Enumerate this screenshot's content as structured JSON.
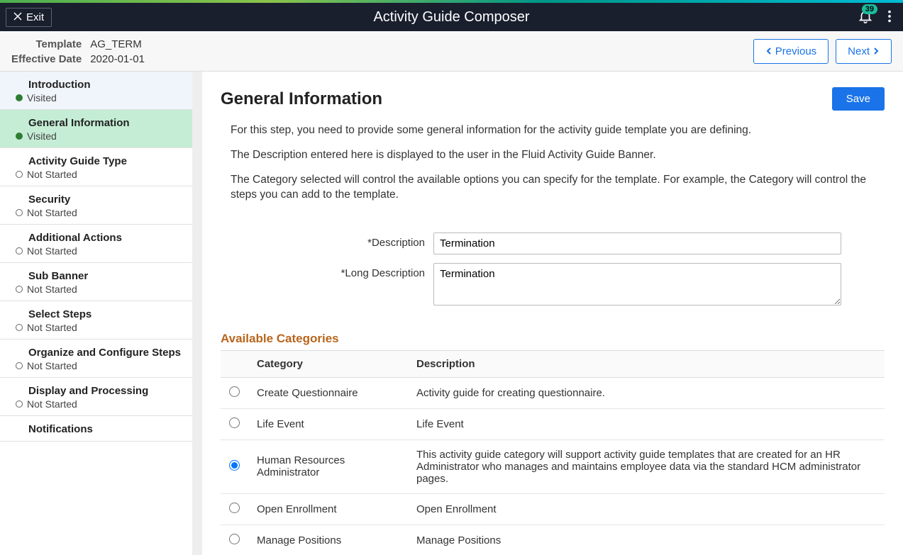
{
  "header": {
    "exit_label": "Exit",
    "title": "Activity Guide Composer",
    "notification_count": "39"
  },
  "context": {
    "template_label": "Template",
    "template_value": "AG_TERM",
    "effdate_label": "Effective Date",
    "effdate_value": "2020-01-01",
    "previous_label": "Previous",
    "next_label": "Next"
  },
  "sidebar": {
    "steps": [
      {
        "title": "Introduction",
        "status": "Visited",
        "visited": true
      },
      {
        "title": "General Information",
        "status": "Visited",
        "visited": true,
        "active": true
      },
      {
        "title": "Activity Guide Type",
        "status": "Not Started",
        "visited": false
      },
      {
        "title": "Security",
        "status": "Not Started",
        "visited": false
      },
      {
        "title": "Additional Actions",
        "status": "Not Started",
        "visited": false
      },
      {
        "title": "Sub Banner",
        "status": "Not Started",
        "visited": false
      },
      {
        "title": "Select Steps",
        "status": "Not Started",
        "visited": false
      },
      {
        "title": "Organize and Configure Steps",
        "status": "Not Started",
        "visited": false
      },
      {
        "title": "Display and Processing",
        "status": "Not Started",
        "visited": false
      },
      {
        "title": "Notifications",
        "status": "",
        "visited": false
      }
    ]
  },
  "main": {
    "heading": "General Information",
    "save_label": "Save",
    "paragraphs": [
      "For this step, you need to provide some general information for the activity guide template you are defining.",
      "The Description entered here is displayed to the user in the Fluid Activity Guide Banner.",
      "The Category selected will control the available options you can specify for the template. For example, the Category will control the steps you can add to the template."
    ],
    "description_label": "*Description",
    "description_value": "Termination",
    "longdesc_label": "*Long Description",
    "longdesc_value": "Termination",
    "categories_heading": "Available Categories",
    "col_category": "Category",
    "col_description": "Description",
    "categories": [
      {
        "name": "Create Questionnaire",
        "desc": "Activity guide for creating questionnaire.",
        "selected": false
      },
      {
        "name": "Life Event",
        "desc": "Life Event",
        "selected": false
      },
      {
        "name": "Human Resources Administrator",
        "desc": "This activity guide category will support activity guide templates that are created for an HR Administrator who manages and maintains employee data via the standard HCM administrator pages.",
        "selected": true
      },
      {
        "name": "Open Enrollment",
        "desc": "Open Enrollment",
        "selected": false
      },
      {
        "name": "Manage Positions",
        "desc": "Manage Positions",
        "selected": false
      }
    ]
  }
}
